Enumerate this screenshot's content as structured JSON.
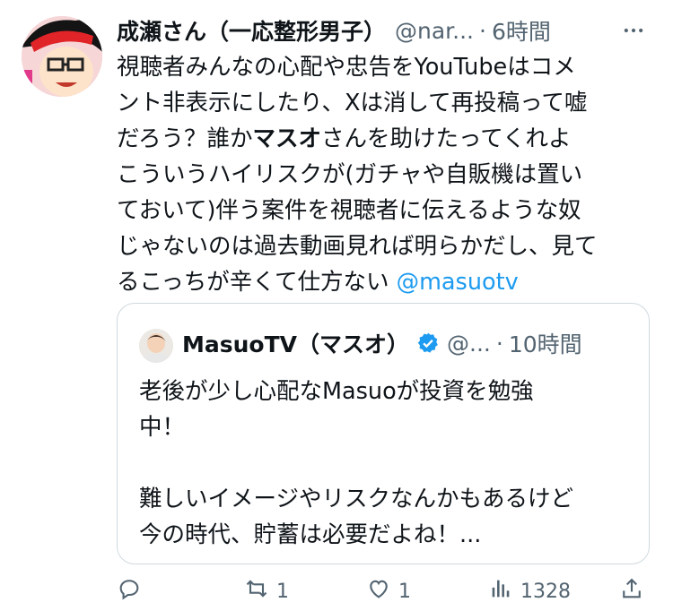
{
  "tweet": {
    "author_name": "成瀬さん（一応整形男子）",
    "handle": "@nar...",
    "separator": "·",
    "time": "6時間",
    "more_icon": "more-horizontal-icon",
    "body_lines": [
      "視聴者みんなの心配や忠告をYouTubeはコメ",
      "ント非表示にしたり、Xは消して再投稿って嘘",
      {
        "before": "だろう？誰か",
        "bold": "マスオ",
        "after": "さんを助けたってくれよ"
      },
      "こういうハイリスクが(ガチャや自販機は置い",
      "ておいて)伴う案件を視聴者に伝えるような奴",
      "じゃないのは過去動画見れば明らかだし、見て",
      {
        "before": "るこっちが辛くて仕方ない ",
        "mention": "@masuotv"
      }
    ]
  },
  "quote": {
    "author_name": "MasuoTV（マスオ）",
    "verified_icon": "verified-badge-icon",
    "handle": "@...",
    "separator": "·",
    "time": "10時間",
    "body_lines": [
      "老後が少し心配なMasuoが投資を勉強",
      "中！",
      "",
      "難しいイメージやリスクなんかもあるけど",
      "今の時代、貯蓄は必要だよね！..."
    ]
  },
  "actions": {
    "reply": {
      "icon": "reply-icon",
      "count": ""
    },
    "repost": {
      "icon": "repost-icon",
      "count": "1"
    },
    "like": {
      "icon": "like-icon",
      "count": "1"
    },
    "views": {
      "icon": "views-icon",
      "count": "1328"
    },
    "share": {
      "icon": "share-icon",
      "count": ""
    }
  },
  "colors": {
    "text": "#0f1419",
    "secondary": "#536471",
    "link": "#1d9bf0",
    "border": "#cfd9de",
    "verified": "#1d9bf0"
  }
}
